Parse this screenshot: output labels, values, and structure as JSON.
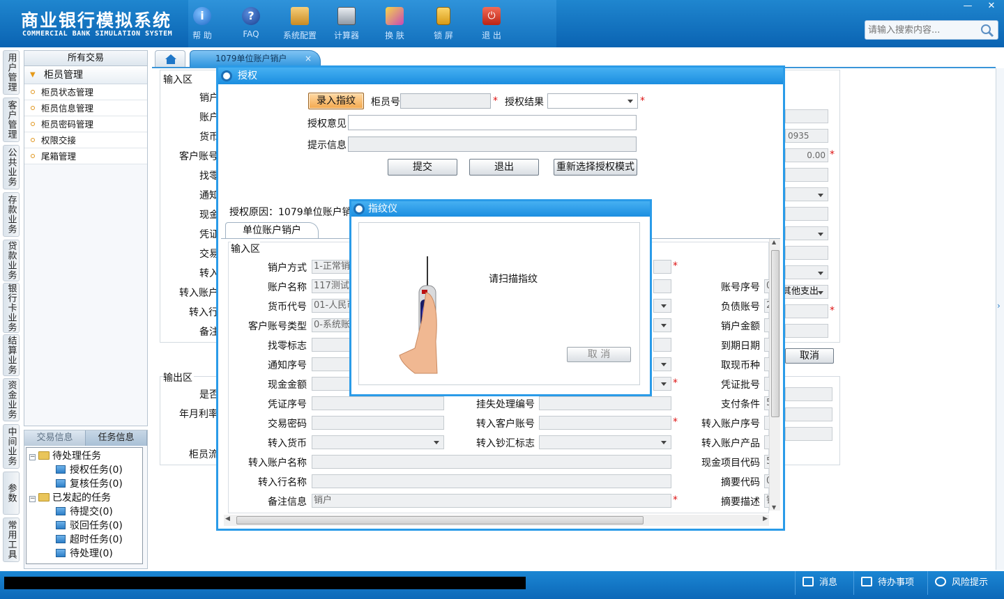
{
  "app": {
    "title_cn": "商业银行模拟系统",
    "title_en": "COMMERCIAL BANK SIMULATION SYSTEM"
  },
  "toolbar": [
    {
      "label": "帮 助",
      "icon": "help-icon",
      "color": "#2d7fd1"
    },
    {
      "label": "FAQ",
      "icon": "faq-icon",
      "color": "#2458a8"
    },
    {
      "label": "系统配置",
      "icon": "config-icon",
      "color": "#e0a23b"
    },
    {
      "label": "计算器",
      "icon": "calculator-icon",
      "color": "#6a7380"
    },
    {
      "label": "换 肤",
      "icon": "skin-icon",
      "color": "#c04bb0"
    },
    {
      "label": "锁 屏",
      "icon": "lock-icon",
      "color": "#e3a520"
    },
    {
      "label": "退 出",
      "icon": "power-icon",
      "color": "#d23a2a"
    }
  ],
  "search": {
    "placeholder": "请输入搜索内容..."
  },
  "window_controls": {
    "minimize": "—",
    "close": "✕"
  },
  "vtabs": [
    "用户管理",
    "客户管理",
    "公共业务",
    "存款业务",
    "贷款业务",
    "银行卡业务",
    "结算业务",
    "资金业务",
    "中间业务",
    "参数",
    "常用工具"
  ],
  "menu": {
    "header": "所有交易",
    "group": "柜员管理",
    "items": [
      "柜员状态管理",
      "柜员信息管理",
      "柜员密码管理",
      "权限交接",
      "尾箱管理"
    ]
  },
  "task_panel": {
    "tabs": [
      "交易信息",
      "任务信息"
    ],
    "pending_group": "待处理任务",
    "pending_items": [
      "授权任务(0)",
      "复核任务(0)"
    ],
    "initiated_group": "已发起的任务",
    "initiated_items": [
      "待提交(0)",
      "驳回任务(0)",
      "超时任务(0)",
      "待处理(0)"
    ]
  },
  "main_tab": {
    "label": "1079单位账户销户",
    "close": "×"
  },
  "background_form": {
    "input_area": "输入区",
    "output_area": "输出区",
    "labels": {
      "l1": "销户",
      "l2": "账户",
      "l3": "货币",
      "l4": "客户账号",
      "l5": "找零",
      "l6": "通知",
      "l7": "现金",
      "l8": "凭证",
      "l9": "交易",
      "l10": "转入",
      "l11": "转入账户",
      "l12": "转入行",
      "l13": "备注",
      "o1": "是否",
      "o2": "年月利率",
      "o3": "柜员流"
    },
    "right_values": {
      "v1": "0935",
      "v2": "0.00",
      "v3": "其他支出"
    },
    "cancel_button": "取消"
  },
  "auth_dialog": {
    "title": "授权",
    "enter_fingerprint": "录入指纹",
    "teller_no_label": "柜员号",
    "auth_result_label": "授权结果",
    "opinion_label": "授权意见",
    "hint_label": "提示信息",
    "submit": "提交",
    "exit": "退出",
    "reselect": "重新选择授权模式",
    "reason": "授权原因：1079单位账户销户",
    "sub_tab": "单位账户销户",
    "input_area": "输入区"
  },
  "form": {
    "left": [
      {
        "label": "销户方式",
        "value": "1-正常销"
      },
      {
        "label": "账户名称",
        "value": "117测试"
      },
      {
        "label": "货币代号",
        "value": "01-人民币"
      },
      {
        "label": "客户账号类型",
        "value": "0-系统账"
      },
      {
        "label": "找零标志",
        "value": ""
      },
      {
        "label": "通知序号",
        "value": ""
      },
      {
        "label": "现金金额",
        "value": ""
      },
      {
        "label": "凭证序号",
        "value": ""
      },
      {
        "label": "交易密码",
        "value": ""
      },
      {
        "label": "转入货币",
        "value": ""
      },
      {
        "label": "转入账户名称",
        "value": ""
      },
      {
        "label": "转入行名称",
        "value": ""
      },
      {
        "label": "备注信息",
        "value": "销户"
      }
    ],
    "middle": [
      {
        "label": "挂失处理编号"
      },
      {
        "label": "转入客户账号"
      },
      {
        "label": "转入钞汇标志"
      }
    ],
    "right": [
      {
        "label": "账号序号",
        "value": "0"
      },
      {
        "label": "负债账号",
        "value": "2"
      },
      {
        "label": "销户金额",
        "value": ""
      },
      {
        "label": "到期日期",
        "value": ""
      },
      {
        "label": "取现币种",
        "value": ""
      },
      {
        "label": "凭证批号",
        "value": ""
      },
      {
        "label": "支付条件",
        "value": "5"
      },
      {
        "label": "转入账户序号",
        "value": ""
      },
      {
        "label": "转入账户产品",
        "value": ""
      },
      {
        "label": "现金项目代码",
        "value": "5"
      },
      {
        "label": "摘要代码",
        "value": "0"
      },
      {
        "label": "摘要描述",
        "value": "销"
      }
    ]
  },
  "fp_dialog": {
    "title": "指纹仪",
    "prompt": "请扫描指纹",
    "cancel": "取 消"
  },
  "statusbar": {
    "messages": "消息",
    "todo": "待办事项",
    "risk": "风险提示"
  }
}
